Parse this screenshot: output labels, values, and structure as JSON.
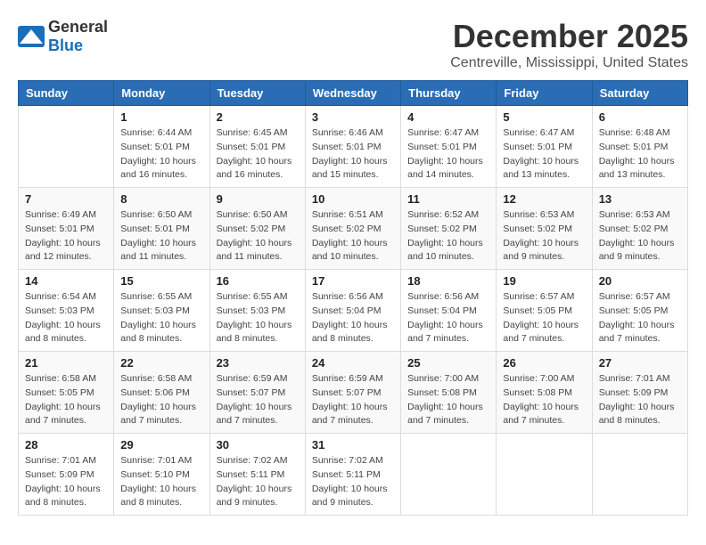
{
  "header": {
    "logo_general": "General",
    "logo_blue": "Blue",
    "month": "December 2025",
    "location": "Centreville, Mississippi, United States"
  },
  "weekdays": [
    "Sunday",
    "Monday",
    "Tuesday",
    "Wednesday",
    "Thursday",
    "Friday",
    "Saturday"
  ],
  "weeks": [
    [
      {
        "day": "",
        "info": ""
      },
      {
        "day": "1",
        "info": "Sunrise: 6:44 AM\nSunset: 5:01 PM\nDaylight: 10 hours\nand 16 minutes."
      },
      {
        "day": "2",
        "info": "Sunrise: 6:45 AM\nSunset: 5:01 PM\nDaylight: 10 hours\nand 16 minutes."
      },
      {
        "day": "3",
        "info": "Sunrise: 6:46 AM\nSunset: 5:01 PM\nDaylight: 10 hours\nand 15 minutes."
      },
      {
        "day": "4",
        "info": "Sunrise: 6:47 AM\nSunset: 5:01 PM\nDaylight: 10 hours\nand 14 minutes."
      },
      {
        "day": "5",
        "info": "Sunrise: 6:47 AM\nSunset: 5:01 PM\nDaylight: 10 hours\nand 13 minutes."
      },
      {
        "day": "6",
        "info": "Sunrise: 6:48 AM\nSunset: 5:01 PM\nDaylight: 10 hours\nand 13 minutes."
      }
    ],
    [
      {
        "day": "7",
        "info": "Sunrise: 6:49 AM\nSunset: 5:01 PM\nDaylight: 10 hours\nand 12 minutes."
      },
      {
        "day": "8",
        "info": "Sunrise: 6:50 AM\nSunset: 5:01 PM\nDaylight: 10 hours\nand 11 minutes."
      },
      {
        "day": "9",
        "info": "Sunrise: 6:50 AM\nSunset: 5:02 PM\nDaylight: 10 hours\nand 11 minutes."
      },
      {
        "day": "10",
        "info": "Sunrise: 6:51 AM\nSunset: 5:02 PM\nDaylight: 10 hours\nand 10 minutes."
      },
      {
        "day": "11",
        "info": "Sunrise: 6:52 AM\nSunset: 5:02 PM\nDaylight: 10 hours\nand 10 minutes."
      },
      {
        "day": "12",
        "info": "Sunrise: 6:53 AM\nSunset: 5:02 PM\nDaylight: 10 hours\nand 9 minutes."
      },
      {
        "day": "13",
        "info": "Sunrise: 6:53 AM\nSunset: 5:02 PM\nDaylight: 10 hours\nand 9 minutes."
      }
    ],
    [
      {
        "day": "14",
        "info": "Sunrise: 6:54 AM\nSunset: 5:03 PM\nDaylight: 10 hours\nand 8 minutes."
      },
      {
        "day": "15",
        "info": "Sunrise: 6:55 AM\nSunset: 5:03 PM\nDaylight: 10 hours\nand 8 minutes."
      },
      {
        "day": "16",
        "info": "Sunrise: 6:55 AM\nSunset: 5:03 PM\nDaylight: 10 hours\nand 8 minutes."
      },
      {
        "day": "17",
        "info": "Sunrise: 6:56 AM\nSunset: 5:04 PM\nDaylight: 10 hours\nand 8 minutes."
      },
      {
        "day": "18",
        "info": "Sunrise: 6:56 AM\nSunset: 5:04 PM\nDaylight: 10 hours\nand 7 minutes."
      },
      {
        "day": "19",
        "info": "Sunrise: 6:57 AM\nSunset: 5:05 PM\nDaylight: 10 hours\nand 7 minutes."
      },
      {
        "day": "20",
        "info": "Sunrise: 6:57 AM\nSunset: 5:05 PM\nDaylight: 10 hours\nand 7 minutes."
      }
    ],
    [
      {
        "day": "21",
        "info": "Sunrise: 6:58 AM\nSunset: 5:05 PM\nDaylight: 10 hours\nand 7 minutes."
      },
      {
        "day": "22",
        "info": "Sunrise: 6:58 AM\nSunset: 5:06 PM\nDaylight: 10 hours\nand 7 minutes."
      },
      {
        "day": "23",
        "info": "Sunrise: 6:59 AM\nSunset: 5:07 PM\nDaylight: 10 hours\nand 7 minutes."
      },
      {
        "day": "24",
        "info": "Sunrise: 6:59 AM\nSunset: 5:07 PM\nDaylight: 10 hours\nand 7 minutes."
      },
      {
        "day": "25",
        "info": "Sunrise: 7:00 AM\nSunset: 5:08 PM\nDaylight: 10 hours\nand 7 minutes."
      },
      {
        "day": "26",
        "info": "Sunrise: 7:00 AM\nSunset: 5:08 PM\nDaylight: 10 hours\nand 7 minutes."
      },
      {
        "day": "27",
        "info": "Sunrise: 7:01 AM\nSunset: 5:09 PM\nDaylight: 10 hours\nand 8 minutes."
      }
    ],
    [
      {
        "day": "28",
        "info": "Sunrise: 7:01 AM\nSunset: 5:09 PM\nDaylight: 10 hours\nand 8 minutes."
      },
      {
        "day": "29",
        "info": "Sunrise: 7:01 AM\nSunset: 5:10 PM\nDaylight: 10 hours\nand 8 minutes."
      },
      {
        "day": "30",
        "info": "Sunrise: 7:02 AM\nSunset: 5:11 PM\nDaylight: 10 hours\nand 9 minutes."
      },
      {
        "day": "31",
        "info": "Sunrise: 7:02 AM\nSunset: 5:11 PM\nDaylight: 10 hours\nand 9 minutes."
      },
      {
        "day": "",
        "info": ""
      },
      {
        "day": "",
        "info": ""
      },
      {
        "day": "",
        "info": ""
      }
    ]
  ]
}
